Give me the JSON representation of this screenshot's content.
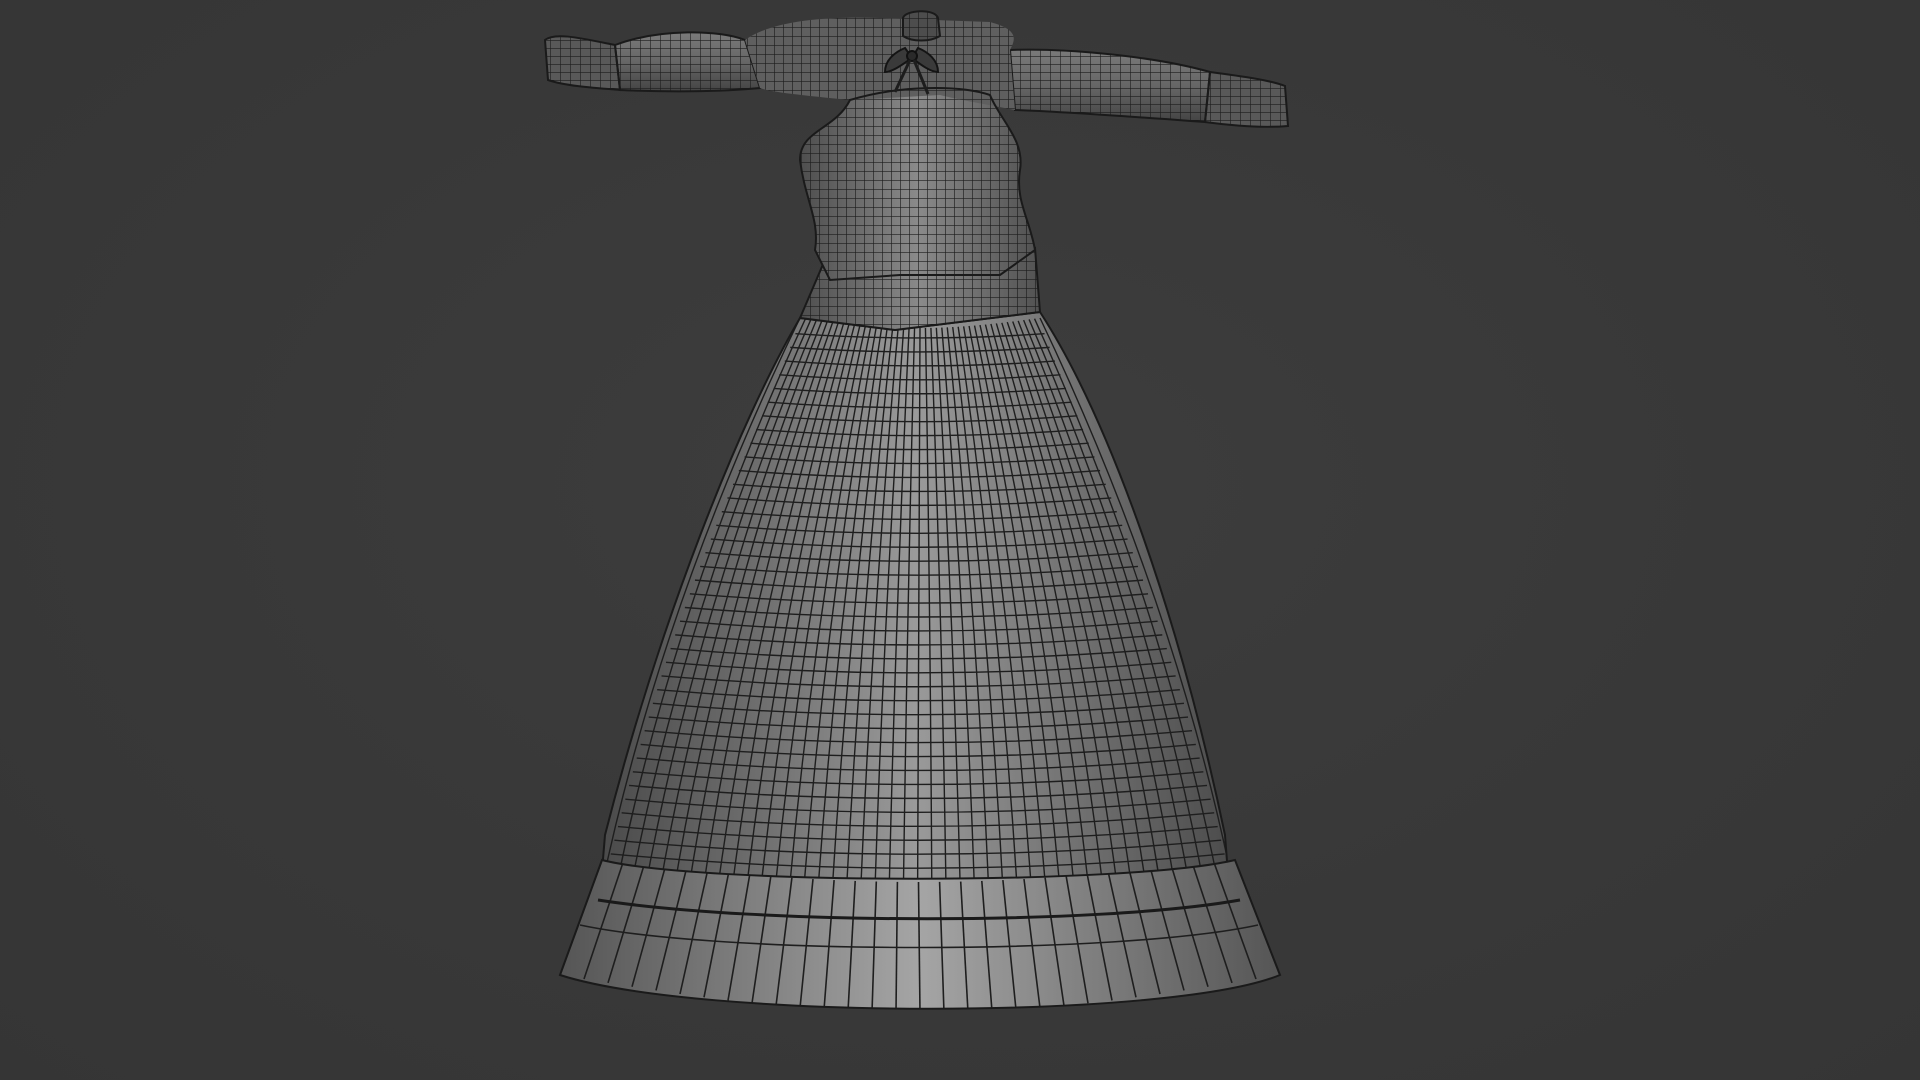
{
  "scene": {
    "background_color": "#3a3a3a",
    "mesh_fill_color": "#8f8f8f",
    "mesh_wire_color": "#1e1e1e",
    "mesh_shadow_color": "#555555"
  }
}
